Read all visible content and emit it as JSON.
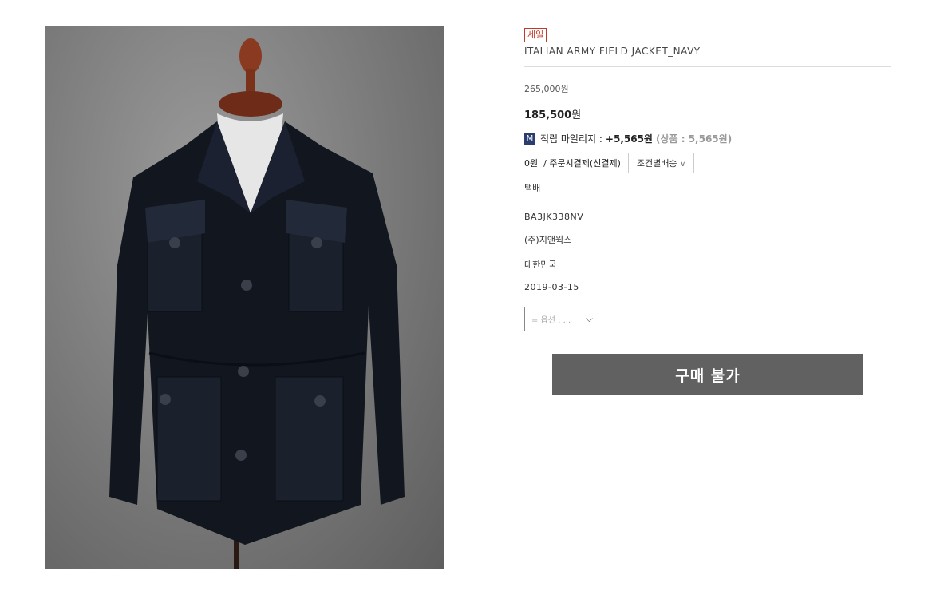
{
  "product": {
    "sale_badge": "세일",
    "title": "ITALIAN ARMY FIELD JACKET_NAVY",
    "price_original": "265,000원",
    "price_sale_amount": "185,500",
    "price_sale_unit": "원",
    "mileage": {
      "icon_label": "M",
      "label": "적립 마일리지 :",
      "amount": "+5,565원",
      "detail": "(상품 : 5,565원)"
    },
    "shipping": {
      "fee": "0원  / 주문시결제(선결제)",
      "button_label": "조건별배송",
      "method": "택배"
    },
    "code": "BA3JK338NV",
    "manufacturer": "(주)지앤웍스",
    "origin": "대한민국",
    "release_date": "2019-03-15",
    "option_placeholder": "= 옵션 : ...",
    "buy_button": "구매 불가"
  },
  "image": {
    "subject": "navy field jacket on mannequin",
    "colors": {
      "background": "#7f7f7f",
      "jacket": "#12161f",
      "mannequin_wood": "#8a3a20"
    }
  },
  "colors": {
    "sale": "#c0392b",
    "mileage_icon": "#2a3d6e",
    "buy_button": "#616161"
  }
}
